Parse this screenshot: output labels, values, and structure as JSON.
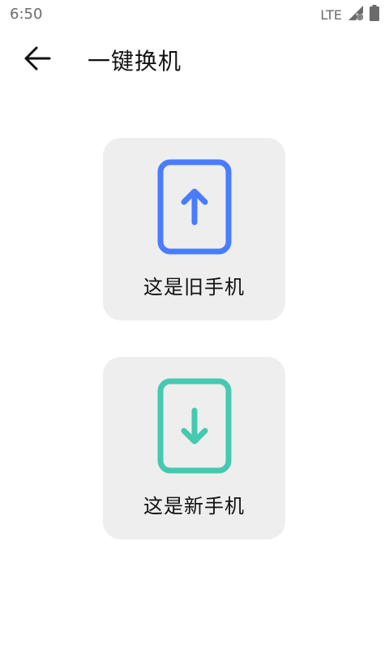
{
  "status_bar": {
    "time": "6:50",
    "network": "LTE"
  },
  "header": {
    "title": "一键换机"
  },
  "options": [
    {
      "label": "这是旧手机",
      "icon": "phone-upload-icon",
      "color": "#4a7cff"
    },
    {
      "label": "这是新手机",
      "icon": "phone-download-icon",
      "color": "#45c9b0"
    }
  ]
}
